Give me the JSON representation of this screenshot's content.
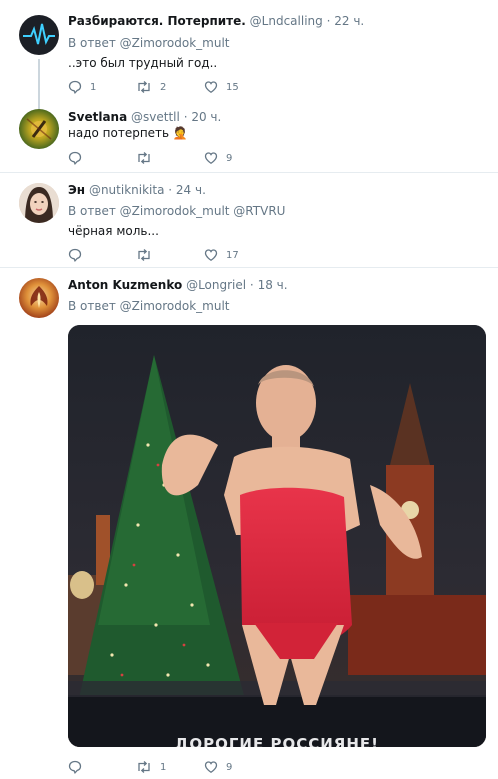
{
  "tweets": [
    {
      "name": "Разбираются. Потерпите.",
      "handle": "@Lndcalling",
      "time": "22 ч.",
      "reply_prefix": "В ответ",
      "reply_to": "@Zimorodok_mult",
      "text": "..это был трудный год..",
      "replies": "1",
      "retweets": "2",
      "likes": "15"
    },
    {
      "name": "Svetlana",
      "handle": "@svettll",
      "time": "20 ч.",
      "text": "надо потерпеть 🤦",
      "replies": "",
      "retweets": "",
      "likes": "9"
    },
    {
      "name": "Эн",
      "handle": "@nutiknikita",
      "time": "24 ч.",
      "reply_prefix": "В ответ",
      "reply_to": "@Zimorodok_mult @RTVRU",
      "text": "чёрная моль...",
      "replies": "",
      "retweets": "",
      "likes": "17"
    },
    {
      "name": "Anton Kuzmenko",
      "handle": "@Longriel",
      "time": "18 ч.",
      "reply_prefix": "В ответ",
      "reply_to": "@Zimorodok_mult",
      "media_caption": "ДОРОГИЕ РОССИЯНЕ!",
      "replies": "",
      "retweets": "1",
      "likes": "9"
    }
  ],
  "dot": "·",
  "colors": {
    "text": "#14171a",
    "secondary": "#657786",
    "border": "#e6ecf0",
    "thread_line": "#ccd6dd"
  }
}
